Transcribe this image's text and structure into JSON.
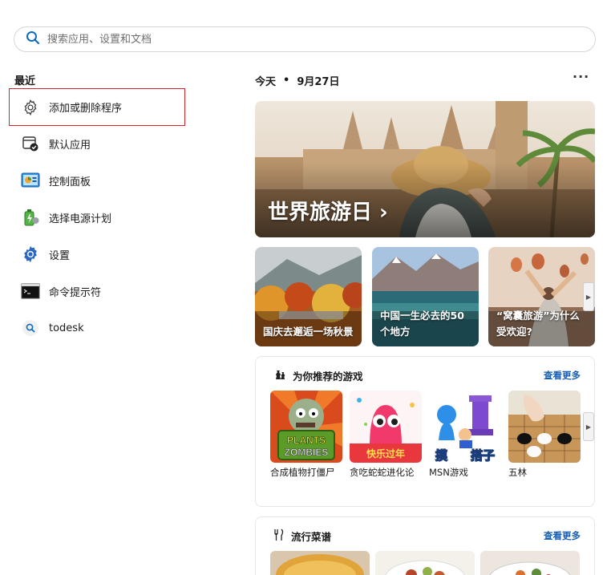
{
  "search": {
    "placeholder": "搜索应用、设置和文档",
    "value": ""
  },
  "recent": {
    "title": "最近",
    "items": [
      {
        "label": "添加或删除程序",
        "icon": "gear-icon",
        "selected": true
      },
      {
        "label": "默认应用",
        "icon": "default-apps-icon"
      },
      {
        "label": "控制面板",
        "icon": "control-panel-icon"
      },
      {
        "label": "选择电源计划",
        "icon": "power-plan-icon"
      },
      {
        "label": "设置",
        "icon": "settings-icon"
      },
      {
        "label": "命令提示符",
        "icon": "command-prompt-icon"
      },
      {
        "label": "todesk",
        "icon": "search-icon"
      }
    ]
  },
  "feed": {
    "today_label": "今天",
    "date": "9月27日",
    "more": "···",
    "hero": {
      "title": "世界旅游日 ›"
    },
    "cards": [
      {
        "title": "国庆去邂逅一场秋景"
      },
      {
        "title": "中国一生必去的50个地方"
      },
      {
        "title": "“窝囊旅游”为什么受欢迎?"
      }
    ],
    "games": {
      "title": "为你推荐的游戏",
      "see_more": "查看更多",
      "items": [
        {
          "name": "合成植物打僵尸",
          "art_text": "PLANTS ZOMBIES"
        },
        {
          "name": "贪吃蛇蛇进化论",
          "art_text": "快乐过年"
        },
        {
          "name": "MSN游戏",
          "art_text": "摸 搭子"
        },
        {
          "name": "五林"
        }
      ]
    },
    "recipes": {
      "title": "流行菜谱",
      "see_more": "查看更多"
    }
  },
  "colors": {
    "accent": "#1a5fb4",
    "highlight_border": "#d3232f"
  }
}
